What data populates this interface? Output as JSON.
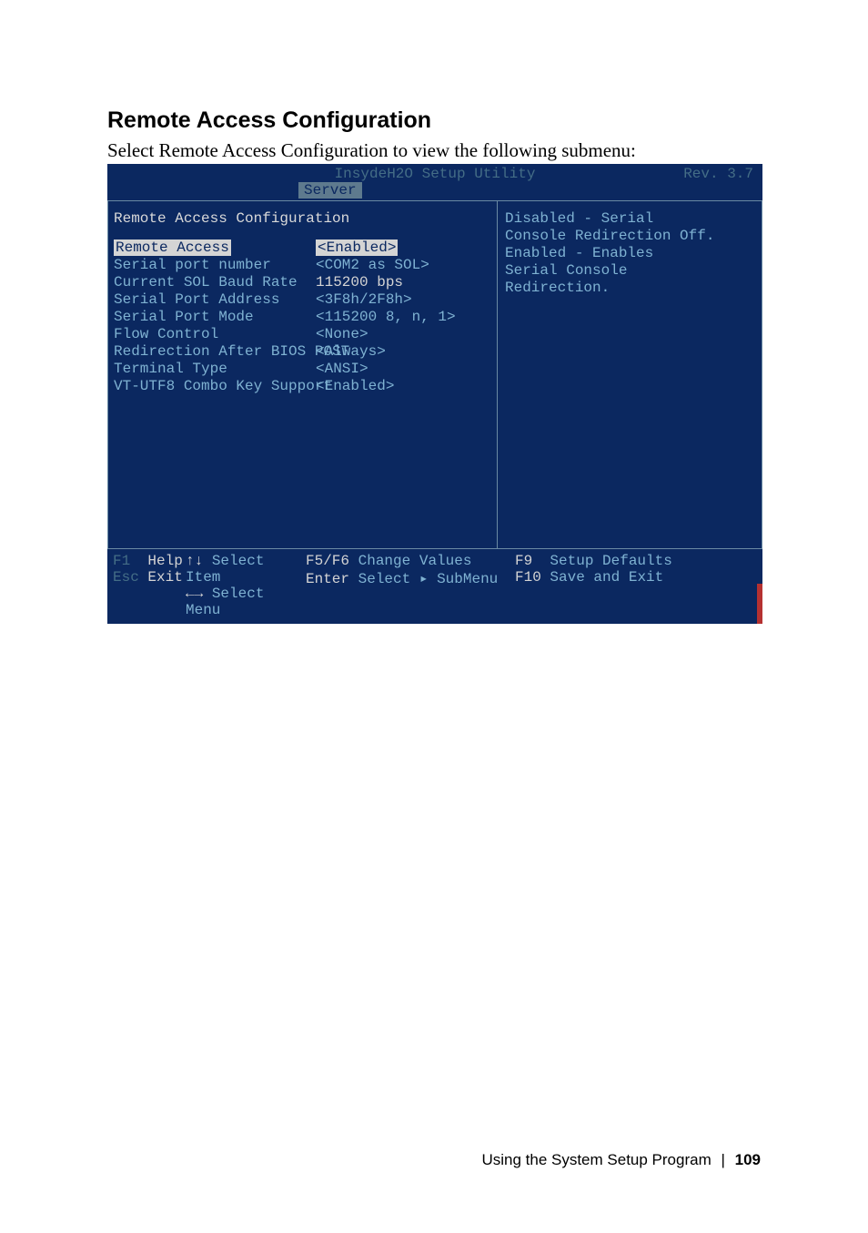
{
  "page": {
    "heading": "Remote Access Configuration",
    "intro": "Select Remote Access Configuration to view the following submenu:",
    "footer_text": "Using the System Setup Program",
    "footer_sep": "|",
    "footer_page": "109"
  },
  "bios": {
    "title": "InsydeH2O Setup Utility",
    "rev": "Rev. 3.7",
    "active_tab": "Server",
    "section_title": "Remote Access Configuration",
    "rows": [
      {
        "label": "Remote Access",
        "value": "<Enabled>",
        "selected": true
      },
      {
        "label": "Serial port number",
        "value": "<COM2 as SOL>"
      },
      {
        "label": "Current SOL Baud Rate",
        "value": "115200 bps",
        "static": true
      },
      {
        "label": "Serial Port Address",
        "value": "<3F8h/2F8h>"
      },
      {
        "label": "Serial Port Mode",
        "value": "<115200 8, n, 1>"
      },
      {
        "label": "Flow Control",
        "value": "<None>"
      },
      {
        "label": "Redirection After BIOS POST",
        "value": "<Always>"
      },
      {
        "label": "Terminal Type",
        "value": "<ANSI>"
      },
      {
        "label": "VT-UTF8 Combo Key Support",
        "value": "<Enabled>"
      }
    ],
    "help": "Disabled - Serial\nConsole Redirection Off.\nEnabled - Enables\nSerial Console\nRedirection.",
    "footer": {
      "f1": {
        "key": "F1",
        "desc": "Help"
      },
      "esc": {
        "key": "Esc",
        "desc": "Exit"
      },
      "updown": {
        "key": "↑↓",
        "desc": "Select Item"
      },
      "leftright": {
        "key": "←→",
        "desc": "Select Menu"
      },
      "f5f6": {
        "key": "F5/F6",
        "desc": "Change Values"
      },
      "enter": {
        "key": "Enter",
        "desc": "Select ▸ SubMenu"
      },
      "f9": {
        "key": "F9",
        "desc": "Setup Defaults"
      },
      "f10": {
        "key": "F10",
        "desc": "Save and Exit"
      }
    }
  }
}
